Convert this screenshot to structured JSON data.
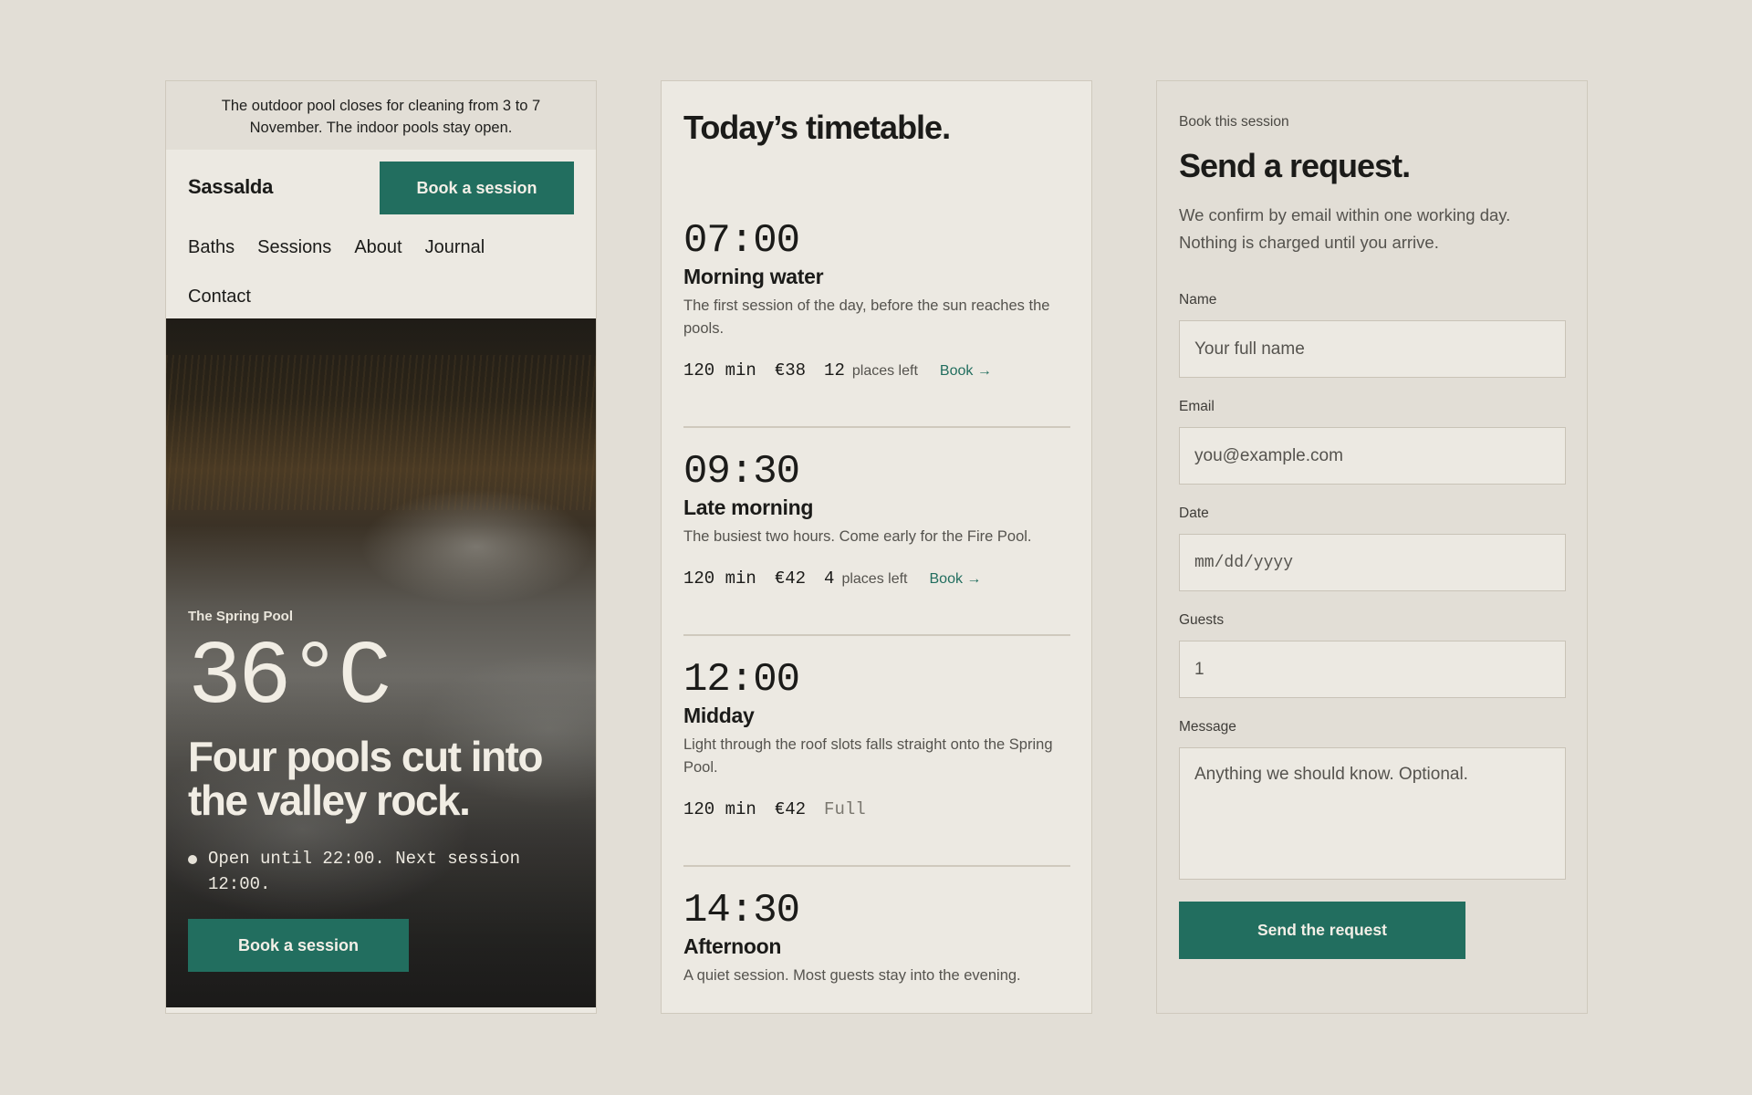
{
  "notice": "The outdoor pool closes for cleaning from 3 to 7 November. The indoor pools stay open.",
  "header": {
    "brand": "Sassalda",
    "book_label": "Book a session",
    "nav": [
      "Baths",
      "Sessions",
      "About",
      "Journal",
      "Contact"
    ]
  },
  "hero": {
    "label": "The Spring Pool",
    "temperature": "36°C",
    "title": "Four pools cut into the valley rock.",
    "status": "Open until 22:00. Next session 12:00.",
    "button": "Book a session"
  },
  "timetable": {
    "title": "Today’s timetable.",
    "sessions": [
      {
        "time": "07:00",
        "name": "Morning water",
        "desc": "The first session of the day, before the sun reaches the pools.",
        "duration": "120 min",
        "price": "€38",
        "places": "12",
        "places_label": "places left",
        "book": "Book →"
      },
      {
        "time": "09:30",
        "name": "Late morning",
        "desc": "The busiest two hours. Come early for the Fire Pool.",
        "duration": "120 min",
        "price": "€42",
        "places": "4",
        "places_label": "places left",
        "book": "Book →"
      },
      {
        "time": "12:00",
        "name": "Midday",
        "desc": "Light through the roof slots falls straight onto the Spring Pool.",
        "duration": "120 min",
        "price": "€42",
        "status": "Full"
      },
      {
        "time": "14:30",
        "name": "Afternoon",
        "desc": "A quiet session. Most guests stay into the evening."
      }
    ]
  },
  "form": {
    "eyebrow": "Book this session",
    "title": "Send a request.",
    "desc": "We confirm by email within one working day. Nothing is charged until you arrive.",
    "fields": {
      "name": {
        "label": "Name",
        "placeholder": "Your full name"
      },
      "email": {
        "label": "Email",
        "placeholder": "you@example.com"
      },
      "date": {
        "label": "Date",
        "placeholder": "mm/dd/yyyy"
      },
      "guests": {
        "label": "Guests",
        "value": "1"
      },
      "message": {
        "label": "Message",
        "placeholder": "Anything we should know. Optional."
      }
    },
    "submit": "Send the request"
  },
  "colors": {
    "accent": "#226e5f",
    "background": "#e2ded6",
    "panel": "#ece9e2"
  },
  "icons": [
    "status-dot-icon",
    "arrow-right-icon"
  ]
}
